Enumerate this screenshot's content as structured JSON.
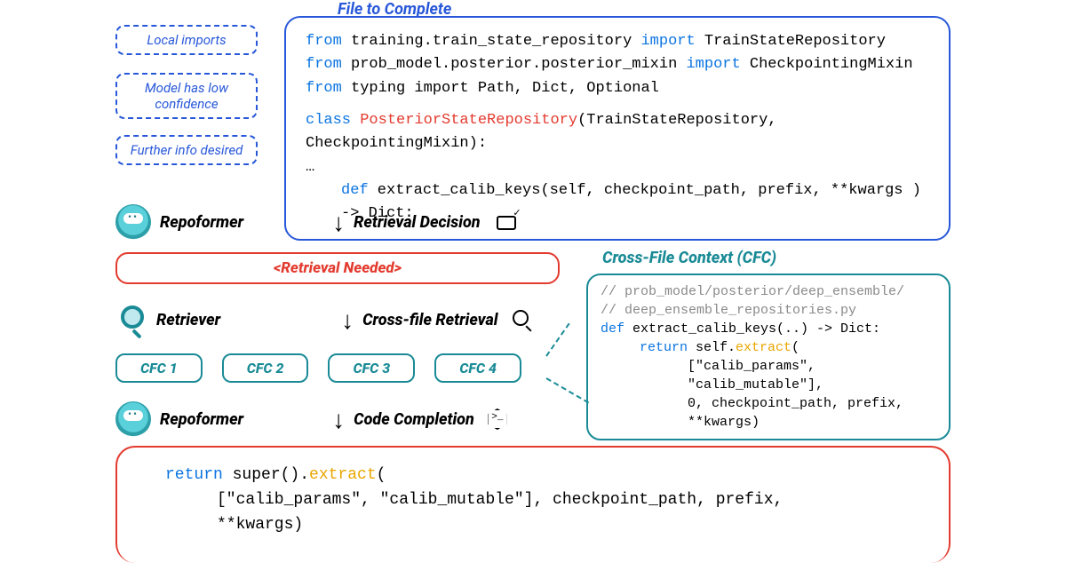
{
  "title": "File to Complete",
  "side_notes": {
    "a": "Local imports",
    "b": "Model has low confidence",
    "c": "Further info desired"
  },
  "file_code": {
    "l1": {
      "from": "from",
      "mod": "training.train_state_repository",
      "imp": "import",
      "cls": "TrainStateRepository"
    },
    "l2": {
      "from": "from",
      "mod": "prob_model.posterior.posterior_mixin",
      "imp": "import",
      "cls": "CheckpointingMixin"
    },
    "l3": {
      "from": "from",
      "mod": "typing import Path, Dict, Optional"
    },
    "l4": {
      "kw": "class",
      "name": "PosteriorStateRepository",
      "rest": "(TrainStateRepository,  CheckpointingMixin):"
    },
    "l5": "      …",
    "l6": {
      "kw": "def",
      "rest": " extract_calib_keys(self, checkpoint_path, prefix, **kwargs ) -> Dict:"
    }
  },
  "steps": {
    "repoformer": "Repoformer",
    "retriever": "Retriever",
    "retrieval_decision": "Retrieval Decision",
    "crossfile_retrieval": "Cross-file Retrieval",
    "code_completion": "Code Completion"
  },
  "banner": "<Retrieval Needed>",
  "cfc": {
    "title": "Cross-File Context (CFC)",
    "items": [
      "CFC 1",
      "CFC 2",
      "CFC 3",
      "CFC 4"
    ],
    "detail": {
      "c1": "// prob_model/posterior/deep_ensemble/",
      "c2": "// deep_ensemble_repositories.py",
      "def": "def",
      "sig": " extract_calib_keys(..) -> Dict:",
      "ret": "return",
      "self_ex": " self.",
      "ex": "extract",
      "open": "(",
      "arr": "[\"calib_params\", \"calib_mutable\"],",
      "rest1": "0, checkpoint_path, prefix,",
      "rest2": "**kwargs)"
    }
  },
  "completion": {
    "ret": "return",
    "sup": " super().",
    "ex": "extract",
    "open": "(",
    "l2": "[\"calib_params\", \"calib_mutable\"], checkpoint_path, prefix,",
    "l3": "**kwargs)"
  }
}
